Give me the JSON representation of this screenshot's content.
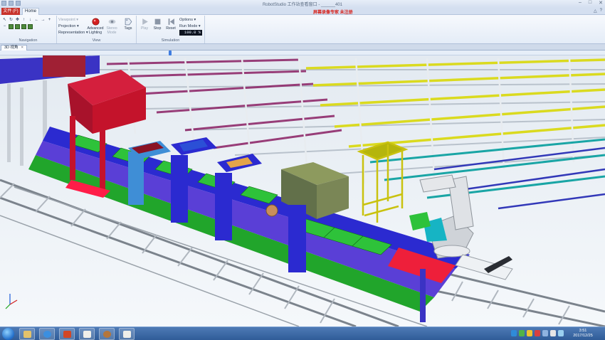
{
  "window": {
    "title": "RobotStudio 工作站查看窗口 - ______401",
    "watermark": "屏幕录像专家  未注册"
  },
  "ribbon_tabs": [
    {
      "label": "文件 (F)",
      "active": false
    },
    {
      "label": "Home",
      "active": true
    }
  ],
  "groups": {
    "navigation": {
      "label": "Navigation"
    },
    "view": {
      "label": "View",
      "viewpoint": "Viewpoint",
      "projection": "Projection",
      "representation": "Representation",
      "advanced_lighting": "Advanced Lighting",
      "stereo_mode": "Stereo Mode",
      "tags": "Tags"
    },
    "simulation": {
      "label": "Simulation",
      "play": "Play",
      "stop": "Stop",
      "reset": "Reset",
      "options": "Options",
      "run_mode": "Run Mode",
      "speed_value": "100.0 %"
    }
  },
  "document_tab": {
    "label": "3D 视角",
    "close": "×"
  },
  "timeline": {
    "position": 0.28
  },
  "taskbar": {
    "apps": [
      "explorer",
      "internet-explorer",
      "powerpoint",
      "robotstudio",
      "media-player",
      "robotstudio-viewer"
    ],
    "clock": {
      "time": "3:51",
      "date": "2017/12/25"
    }
  },
  "colors": {
    "file_tab": "#c8332c",
    "conveyor_blue": "#2b2ad0",
    "conveyor_green": "#21a52b",
    "hopper_red": "#c4132b",
    "rack_white": "#e8ecf0",
    "shelf_yellow": "#dada1f",
    "shelf_magenta": "#8a1f63",
    "taskbar": "#3a68a6"
  }
}
